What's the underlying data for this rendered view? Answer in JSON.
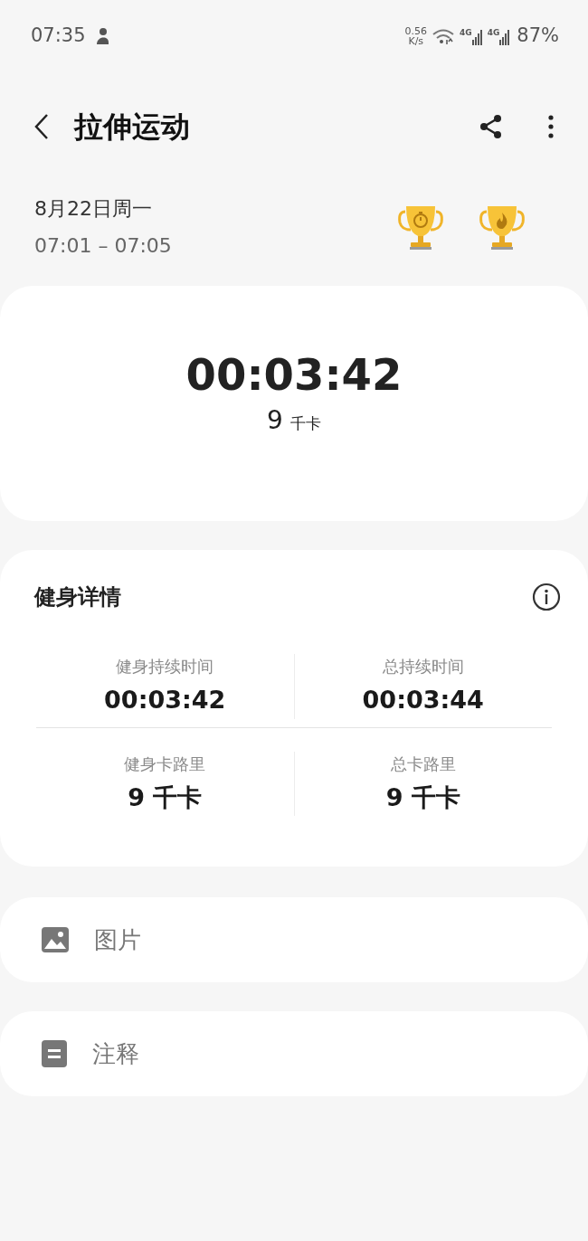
{
  "status_bar": {
    "time": "07:35",
    "net_speed": "0.56",
    "net_unit": "K/s",
    "networks": [
      "4G",
      "4G"
    ],
    "battery": "87%"
  },
  "header": {
    "title": "拉伸运动"
  },
  "session": {
    "date": "8月22日周一",
    "time_range": "07:01 – 07:05"
  },
  "summary": {
    "duration": "00:03:42",
    "calories": "9",
    "calories_unit": "千卡"
  },
  "details": {
    "title": "健身详情",
    "stats": [
      {
        "label": "健身持续时间",
        "value": "00:03:42"
      },
      {
        "label": "总持续时间",
        "value": "00:03:44"
      },
      {
        "label": "健身卡路里",
        "value": "9 千卡"
      },
      {
        "label": "总卡路里",
        "value": "9 千卡"
      }
    ]
  },
  "attachments": [
    {
      "kind": "image",
      "label": "图片"
    },
    {
      "kind": "note",
      "label": "注释"
    }
  ]
}
